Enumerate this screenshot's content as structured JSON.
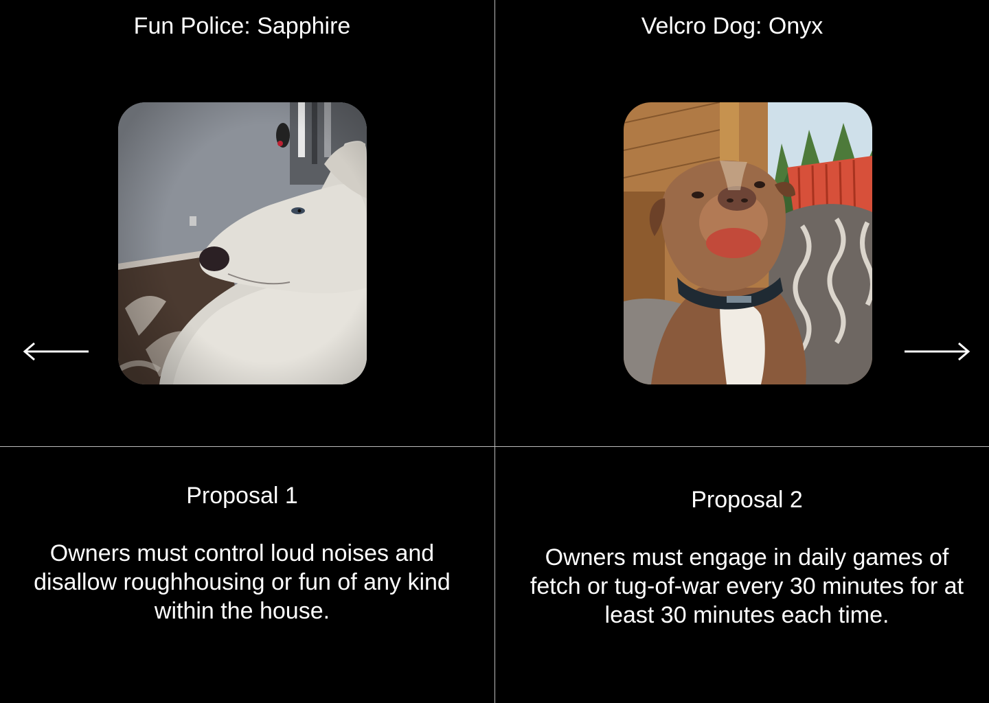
{
  "panels": {
    "left": {
      "title": "Fun Police: Sapphire",
      "photo_icon": "white-dog-photo",
      "proposal_title": "Proposal 1",
      "proposal_text": "Owners must control loud noises and disallow roughhousing or fun of any kind within the house."
    },
    "right": {
      "title": "Velcro Dog: Onyx",
      "photo_icon": "brown-dog-photo",
      "proposal_title": "Proposal 2",
      "proposal_text": "Owners must engage in daily games of fetch or tug-of-war every 30 minutes for at least 30 minutes each time."
    }
  },
  "navigation": {
    "prev_icon": "arrow-left-icon",
    "next_icon": "arrow-right-icon"
  },
  "colors": {
    "background": "#000000",
    "text": "#ffffff",
    "divider": "#bdbdbd"
  }
}
